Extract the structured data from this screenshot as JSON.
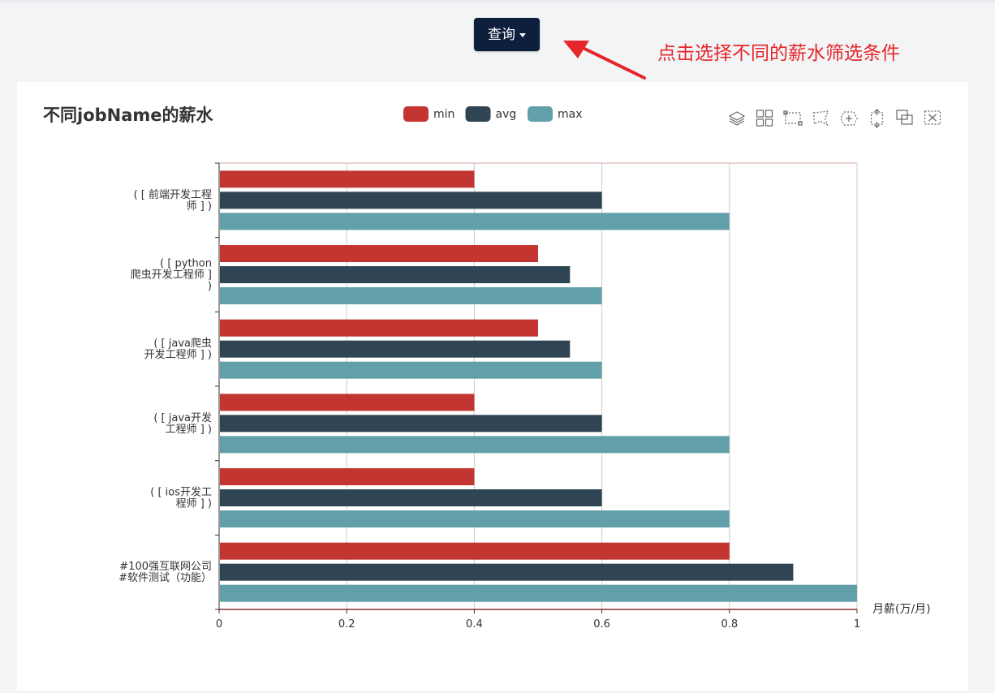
{
  "header": {
    "query_label": "查询",
    "annotation_text": "点击选择不同的薪水筛选条件"
  },
  "colors": {
    "min": "#c23531",
    "avg": "#2f4554",
    "max": "#61a0a8",
    "button_bg": "#0e1f3d",
    "annotation": "#e5262a"
  },
  "toolbox": [
    "stack-icon",
    "tiled-icon",
    "rect-select-icon",
    "lasso-select-icon",
    "keep-select-icon",
    "clear-select-icon",
    "zoom-icon",
    "zoom-reset-icon"
  ],
  "chart_data": {
    "type": "bar",
    "orientation": "horizontal",
    "title": "不同jobName的薪水",
    "xlabel": "月薪(万/月)",
    "ylabel": "",
    "xlim": [
      0,
      1
    ],
    "x_ticks": [
      "0",
      "0.2",
      "0.4",
      "0.6",
      "0.8",
      "1"
    ],
    "grid": true,
    "legend_position": "top-center",
    "categories": [
      [
        "( [ 前端开发工程",
        "师 ] )"
      ],
      [
        "( [ python",
        "爬虫开发工程师 ]",
        ")"
      ],
      [
        "( [ java爬虫",
        "开发工程师 ] )"
      ],
      [
        "( [ java开发",
        "工程师 ] )"
      ],
      [
        "( [ ios开发工",
        "程师 ] )"
      ],
      [
        "#100强互联网公司",
        "#软件测试（功能）"
      ]
    ],
    "series": [
      {
        "name": "min",
        "values": [
          0.4,
          0.5,
          0.5,
          0.4,
          0.4,
          0.8
        ]
      },
      {
        "name": "avg",
        "values": [
          0.6,
          0.55,
          0.55,
          0.6,
          0.6,
          0.9
        ]
      },
      {
        "name": "max",
        "values": [
          0.8,
          0.6,
          0.6,
          0.8,
          0.8,
          1.0
        ]
      }
    ]
  }
}
